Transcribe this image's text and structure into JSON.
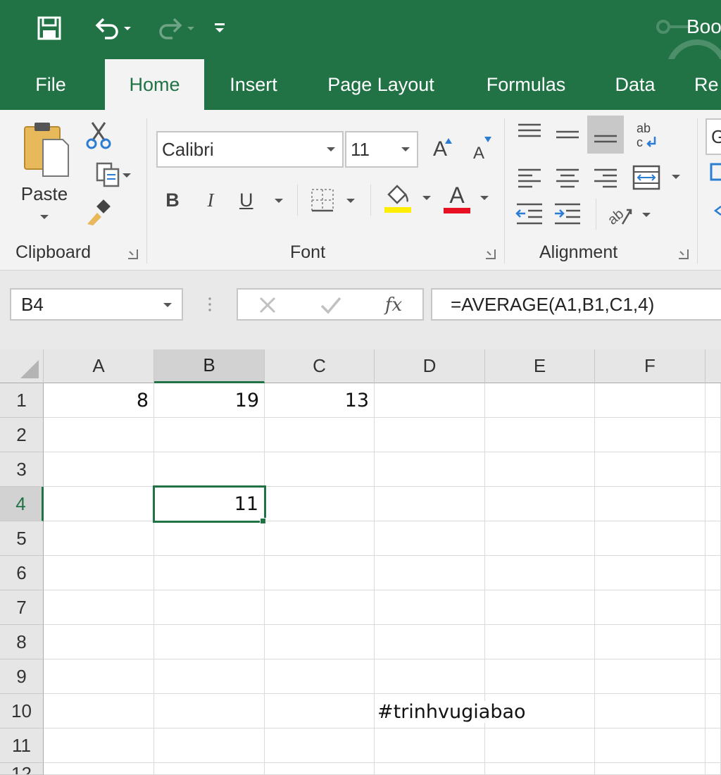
{
  "app": {
    "document_title": "Boo",
    "colors": {
      "accent": "#217346",
      "ribbon_bg": "#f3f3f3",
      "font_color_bar": "#e81123",
      "highlight_bar": "#ffee00"
    }
  },
  "quick_access": [
    {
      "icon": "save-icon"
    },
    {
      "icon": "undo-icon"
    },
    {
      "icon": "redo-icon"
    },
    {
      "icon": "customize-qat-icon"
    }
  ],
  "tabs": [
    "File",
    "Home",
    "Insert",
    "Page Layout",
    "Formulas",
    "Data",
    "Re"
  ],
  "active_tab": "Home",
  "ribbon": {
    "clipboard": {
      "paste_label": "Paste",
      "group_label": "Clipboard"
    },
    "font": {
      "font_name": "Calibri",
      "font_size": "11",
      "group_label": "Font",
      "bold": "B",
      "italic": "I",
      "underline": "U",
      "grow": "A",
      "shrink": "A",
      "font_color_letter": "A"
    },
    "alignment": {
      "group_label": "Alignment",
      "wrap_text_icon": "ab c"
    },
    "number_partial": "G"
  },
  "formula_bar": {
    "name_box": "B4",
    "formula": "=AVERAGE(A1,B1,C1,4)",
    "fx_label": "fx"
  },
  "grid": {
    "columns": [
      "A",
      "B",
      "C",
      "D",
      "E",
      "F"
    ],
    "rows": [
      "1",
      "2",
      "3",
      "4",
      "5",
      "6",
      "7",
      "8",
      "9",
      "10",
      "11",
      "12"
    ],
    "selected_cell": "B4",
    "cells": {
      "A1": "8",
      "B1": "19",
      "C1": "13",
      "B4": "11",
      "D10": "#trinhvugiabao"
    }
  }
}
